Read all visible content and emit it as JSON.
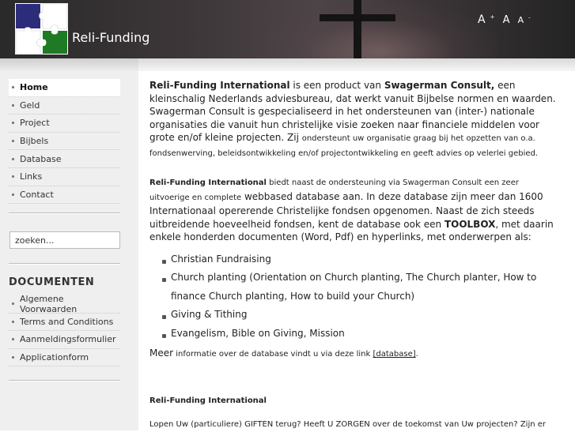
{
  "header": {
    "site_name": "Reli-Funding",
    "font_tools": {
      "increase": "A",
      "increase_sup": "+",
      "normal": "A",
      "decrease": "A",
      "decrease_sup": "-"
    },
    "puzzle_colors": [
      "#2b2d7a",
      "#ffffff",
      "#ffffff",
      "#1e7a24"
    ]
  },
  "sidebar": {
    "nav": [
      "Home",
      "Geld",
      "Project",
      "Bijbels",
      "Database",
      "Links",
      "Contact"
    ],
    "active_nav": "Home",
    "search_value": "zoeken...",
    "documents_title": "DOCUMENTEN",
    "documents": [
      "Algemene Voorwaarden",
      "Terms and Conditions",
      "Aanmeldingsformulier",
      "Applicationform"
    ]
  },
  "content": {
    "p1": {
      "b1": "Reli-Funding International",
      "t1": " is een product van ",
      "b2": "Swagerman Consult,",
      "t2": " een kleinschalig Nederlands adviesbureau, dat werkt vanuit Bijbelse normen en waarden. Swagerman Consult is gespecialiseerd in het ondersteunen van (inter-) nationale organisaties die vanuit hun christelijke visie zoeken naar financiele middelen voor grote en/of kleine projecten. Zij ",
      "small": "ondersteunt uw organisatie graag bij het opzetten van o.a. fondsenwerving, beleidsontwikkeling en/of projectontwikkeling en geeft advies op velerlei gebied."
    },
    "p2": {
      "b1": "Reli-Funding International",
      "s1": " biedt naast de ondersteuning via Swagerman Consult een zeer uitvoerige en complete",
      "t1": " webbased database aan. In deze database zijn meer dan 1600 Internationaal opererende Christelijke fondsen opgenomen. Naast de zich steeds uitbreidende hoeveelheid fondsen, kent de database ook een ",
      "b2": "TOOLBOX",
      "t2": ", met daarin enkele honderden documenten (Word, Pdf) en hyperlinks, met onderwerpen als:"
    },
    "list": [
      "Christian Fundraising",
      "Church planting (Orientation on Church planting, The Church planter, How to finance Church planting, How to build your Church)",
      "Giving & Tithing",
      "Evangelism, Bible on Giving, Mission"
    ],
    "more": {
      "t1": "Meer",
      "s1": " informatie over de database vindt u via deze link ",
      "link": "[database]",
      "s2": "."
    },
    "heading2": "Reli-Funding International",
    "p3": "Lopen Uw (particuliere) GIFTEN terug? Heeft U ZORGEN over de toekomst van Uw projecten? Zijn er"
  }
}
